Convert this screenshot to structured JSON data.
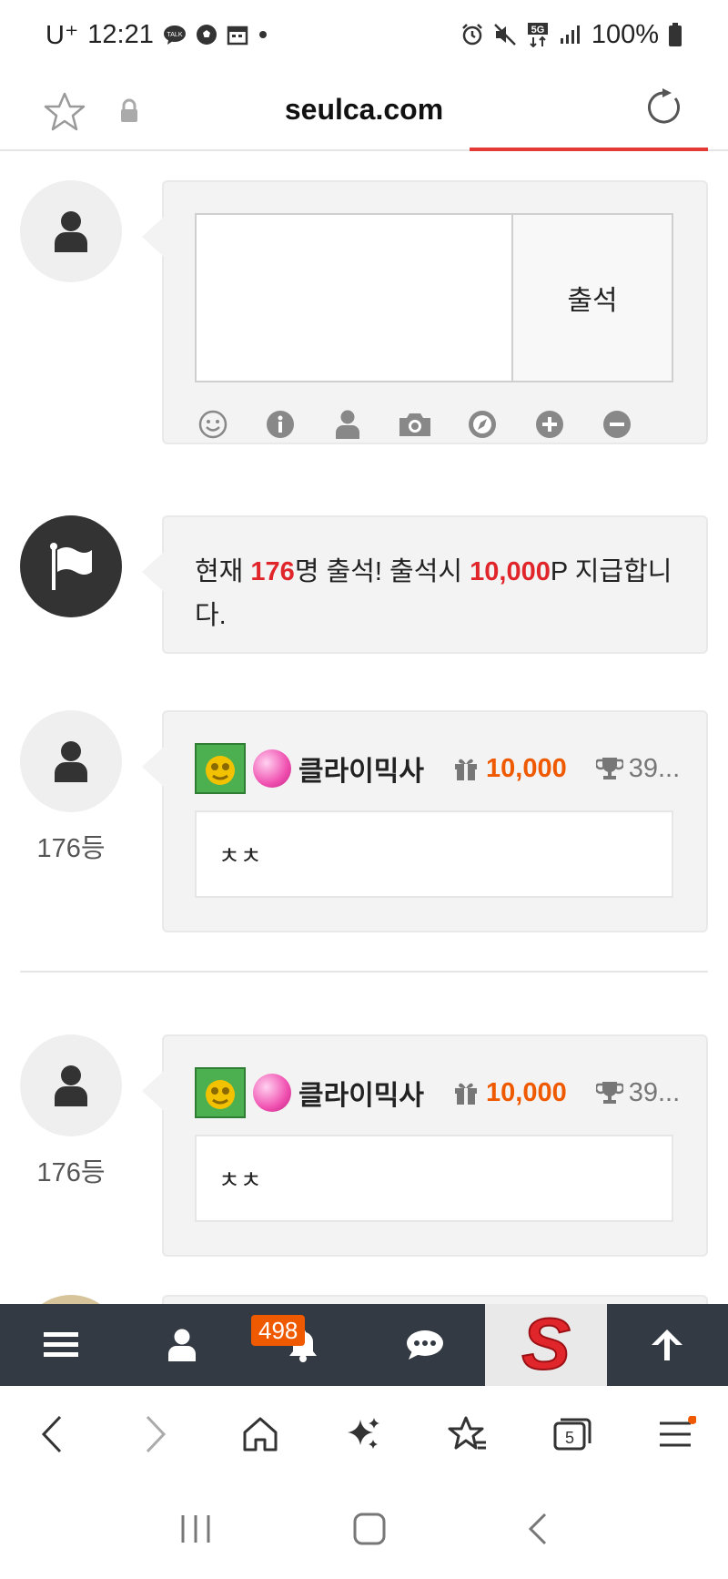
{
  "status_bar": {
    "carrier": "U⁺",
    "time": "12:21",
    "battery": "100%",
    "network": "5G"
  },
  "url_bar": {
    "domain": "seulca.com"
  },
  "attendance_form": {
    "submit_label": "출석",
    "tool_icons": [
      "emoji-icon",
      "info-icon",
      "user-icon",
      "camera-icon",
      "compass-icon",
      "plus-icon",
      "minus-icon"
    ]
  },
  "notice": {
    "prefix": "현재 ",
    "count": "176",
    "mid1": "명 출석! 출석시 ",
    "points": "10,000",
    "suffix": "P 지급합니다."
  },
  "entries": [
    {
      "rank": "176등",
      "nickname": "클라이믹사",
      "points": "10,000",
      "trophy": "39...",
      "comment": "ㅊㅊ"
    },
    {
      "rank": "176등",
      "nickname": "클라이믹사",
      "points": "10,000",
      "trophy": "39...",
      "comment": "ㅊㅊ"
    }
  ],
  "bottom_nav": {
    "notification_count": "498",
    "items": [
      "menu-icon",
      "user-icon",
      "bell-icon",
      "chat-icon",
      "site-logo",
      "arrow-up-icon"
    ],
    "logo_text": "S"
  },
  "browser_bar": {
    "tab_count": "5"
  },
  "colors": {
    "accent_red": "#e0252b",
    "points_orange": "#ef5a00",
    "nav_dark": "#333a43"
  }
}
